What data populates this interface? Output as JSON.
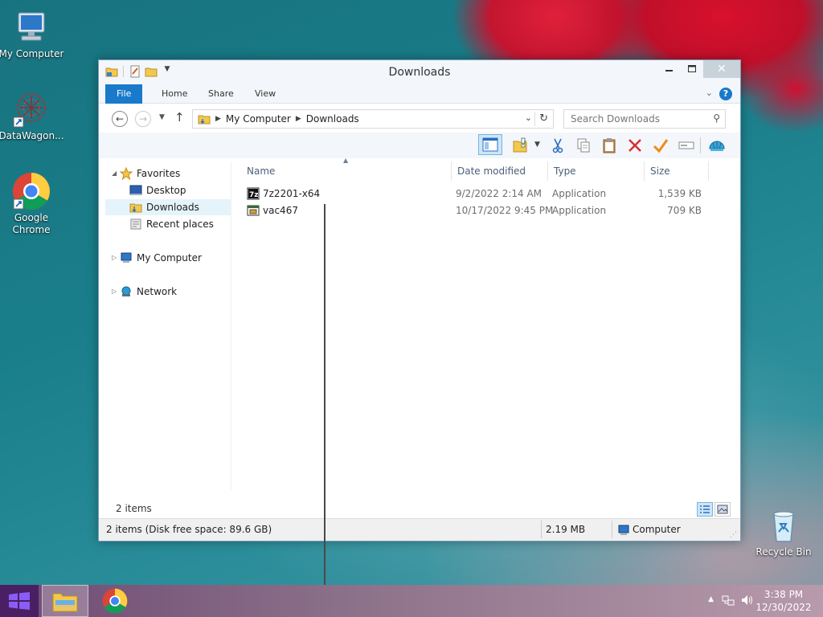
{
  "desktop": {
    "icons": [
      {
        "label": "My Computer"
      },
      {
        "label": "DataWagon..."
      },
      {
        "label": "Google Chrome"
      },
      {
        "label": "Recycle Bin"
      }
    ]
  },
  "window": {
    "title": "Downloads",
    "ribbon_tabs": [
      "File",
      "Home",
      "Share",
      "View"
    ],
    "address": {
      "crumbs": [
        "My Computer",
        "Downloads"
      ]
    },
    "search": {
      "placeholder": "Search Downloads"
    },
    "nav": {
      "favorites_label": "Favorites",
      "favorites": [
        "Desktop",
        "Downloads",
        "Recent places"
      ],
      "my_computer": "My Computer",
      "network": "Network"
    },
    "columns": [
      "Name",
      "Date modified",
      "Type",
      "Size"
    ],
    "files": [
      {
        "name": "7z2201-x64",
        "date": "9/2/2022 2:14 AM",
        "type": "Application",
        "size": "1,539 KB"
      },
      {
        "name": "vac467",
        "date": "10/17/2022 9:45 PM",
        "type": "Application",
        "size": "709 KB"
      }
    ],
    "item_count": "2 items",
    "status": {
      "left": "2 items (Disk free space: 89.6 GB)",
      "size": "2.19 MB",
      "location": "Computer"
    }
  },
  "taskbar": {
    "time": "3:38 PM",
    "date": "12/30/2022"
  },
  "colors": {
    "accent": "#1979ca",
    "selection": "#e5f3fb"
  }
}
